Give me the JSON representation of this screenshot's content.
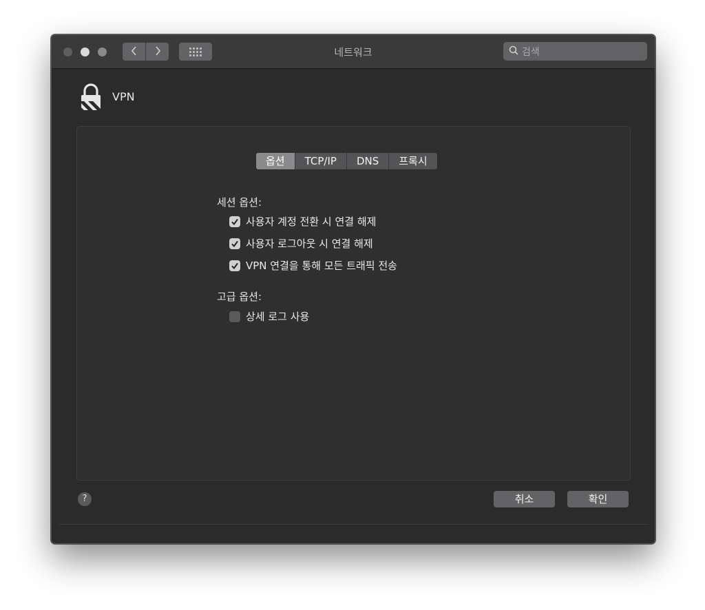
{
  "window": {
    "title": "네트워크"
  },
  "search": {
    "placeholder": "검색"
  },
  "header": {
    "title": "VPN"
  },
  "tabs": [
    {
      "label": "옵션",
      "active": true
    },
    {
      "label": "TCP/IP",
      "active": false
    },
    {
      "label": "DNS",
      "active": false
    },
    {
      "label": "프록시",
      "active": false
    }
  ],
  "session_options": {
    "label": "세션 옵션:",
    "items": [
      {
        "label": "사용자 계정 전환 시 연결 해제",
        "checked": true
      },
      {
        "label": "사용자 로그아웃 시 연결 해제",
        "checked": true
      },
      {
        "label": "VPN 연결을 통해 모든 트래픽 전송",
        "checked": true
      }
    ]
  },
  "advanced_options": {
    "label": "고급 옵션:",
    "items": [
      {
        "label": "상세 로그 사용",
        "checked": false
      }
    ]
  },
  "footer": {
    "help_label": "?",
    "cancel_label": "취소",
    "ok_label": "확인"
  },
  "icons": {
    "lock": "lock-icon",
    "search": "search-icon",
    "back": "chevron-left-icon",
    "forward": "chevron-right-icon",
    "grid": "grid-icon",
    "check": "checkmark-icon"
  }
}
